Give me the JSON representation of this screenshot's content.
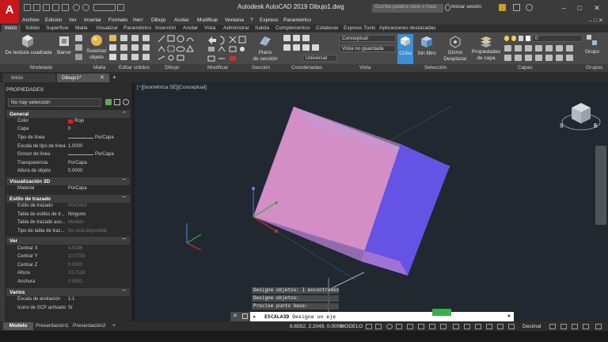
{
  "window": {
    "title": "Autodesk AutoCAD 2019   Dibujo1.dwg",
    "search_placeholder": "Escriba palabra clave o frase",
    "signin": "Iniciar sesión",
    "logo": "A"
  },
  "menubar": [
    "Archivo",
    "Edición",
    "Ver",
    "Insertar",
    "Formato",
    "Herr",
    "Dibujo",
    "Acotar",
    "Modificar",
    "Ventana",
    "?",
    "Express",
    "Parametrico"
  ],
  "ribbon_tabs": [
    "Inicio",
    "Sólido",
    "Superficie",
    "Malla",
    "Visualizar",
    "Paramétrico",
    "Inserción",
    "Anotar",
    "Vista",
    "Administrar",
    "Salida",
    "Complementos",
    "Colaborar",
    "Express Tools",
    "Aplicaciones destacadas"
  ],
  "ribbon": {
    "box_label": "De textura cuadrada",
    "extrude_label": "Barrer",
    "smooth_label_1": "Suavizar",
    "smooth_label_2": "objeto",
    "section_label_1": "Plano",
    "section_label_2": "de sección",
    "visual_style": "Conceptual",
    "view_combo": "Vista no guardada",
    "ucs_combo": "Universal",
    "cull_label": "Criba",
    "nofilter_label": "Sin filtro",
    "gizmo_label_1": "Gizmo",
    "gizmo_label_2": "Desplazar",
    "layer_props_1": "Propiedades",
    "layer_props_2": "de capa",
    "layer_combo": "0",
    "groups_label": "Grupo",
    "groups": [
      "Modelado",
      "Malla",
      "Editar sólidos",
      "Dibujo",
      "Modificar",
      "Sección",
      "Coordenadas",
      "Vista",
      "Selección",
      "Capas",
      "Grupos"
    ]
  },
  "file_tabs": {
    "start": "Inicio",
    "drawing": "Dibujo1*"
  },
  "properties": {
    "title": "PROPIEDADES",
    "selection": "No hay selección",
    "sections": {
      "general": "General",
      "vis3d": "Visualización 3D",
      "plot": "Estilo de trazado",
      "view": "Ver",
      "misc": "Varios"
    },
    "general_rows": [
      {
        "label": "Color",
        "value": "Rojo"
      },
      {
        "label": "Capa",
        "value": "0"
      },
      {
        "label": "Tipo de línea",
        "value": "PorCapa"
      },
      {
        "label": "Escala de tipo de línea",
        "value": "1.0000"
      },
      {
        "label": "Grosor de línea",
        "value": "PorCapa"
      },
      {
        "label": "Transparencia",
        "value": "PorCapa"
      },
      {
        "label": "Altura de objeto",
        "value": "0.0000"
      }
    ],
    "vis3d_rows": [
      {
        "label": "Material",
        "value": "PorCapa"
      }
    ],
    "plot_rows": [
      {
        "label": "Estilo de trazado",
        "value": "PorColor"
      },
      {
        "label": "Tabla de estilos de tr...",
        "value": "Ninguno"
      },
      {
        "label": "Tabla de trazado aso...",
        "value": "Modelo"
      },
      {
        "label": "Tipo de tabla de traz...",
        "value": "No está disponible"
      }
    ],
    "view_rows": [
      {
        "label": "Centrar X",
        "value": "4.9186"
      },
      {
        "label": "Centrar Y",
        "value": "10.0793"
      },
      {
        "label": "Centrar Z",
        "value": "0.0000"
      },
      {
        "label": "Altura",
        "value": "13.7118"
      },
      {
        "label": "Anchura",
        "value": "0.9351"
      }
    ],
    "misc_rows": [
      {
        "label": "Escala de anotación",
        "value": "1:1"
      },
      {
        "label": "Icono de SCP activado",
        "value": "Sí"
      }
    ]
  },
  "viewport": {
    "label": "[−][Isométrica SE][Conceptual]",
    "viewcube_s": "S",
    "viewcube_e": "E"
  },
  "command": {
    "history": [
      "Designe objetos: 1 encontrados",
      "Designe objetos:",
      "Precise punto base:"
    ],
    "prompt_cmd": "ESCALA3D",
    "prompt_text": "Designe un eje"
  },
  "status": {
    "layout_model": "Modelo",
    "layouts": [
      "Presentación1",
      "Presentación2"
    ],
    "add": "+",
    "coords": "8.6552, 2.2049, 0.0000",
    "model": "MODELO",
    "units": "Decimal"
  },
  "colors": {
    "cube_top": "#d88fc9",
    "cube_front": "#d27ec4",
    "cube_side": "#6a55e8",
    "accent": "#3c8fd4"
  }
}
